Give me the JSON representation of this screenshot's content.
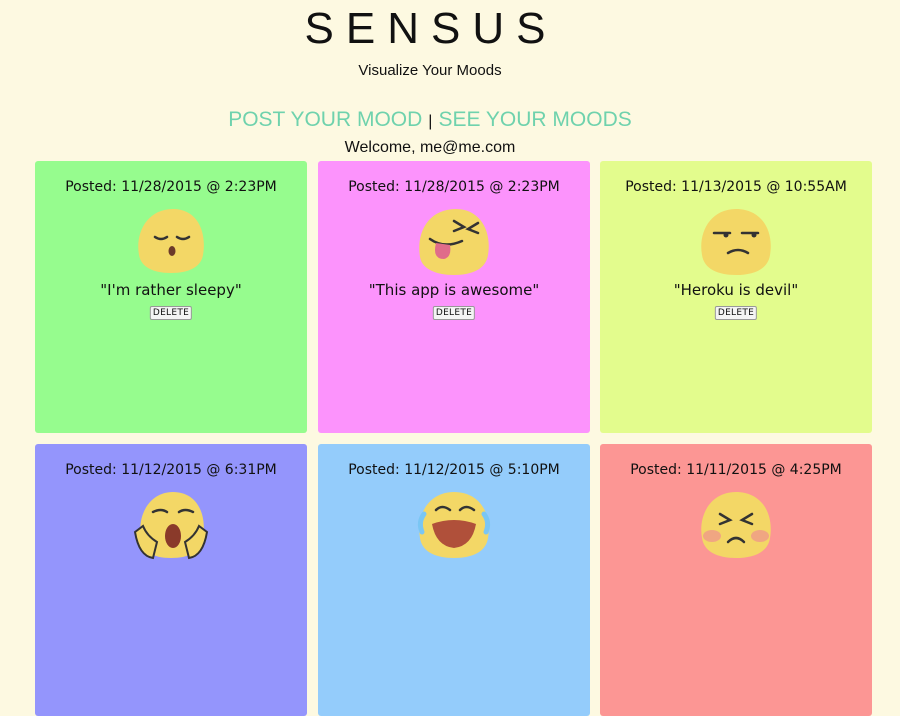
{
  "header": {
    "logo": "SENSUS",
    "tagline": "Visualize Your Moods",
    "nav_post": "POST YOUR MOOD",
    "nav_sep": "|",
    "nav_see": "SEE YOUR MOODS",
    "welcome": "Welcome, me@me.com"
  },
  "colors": {
    "background": "#fdf9e1",
    "accent": "#6fd2ad"
  },
  "moods": [
    {
      "posted": "Posted: 11/28/2015 @ 2:23PM",
      "quote": "\"I'm rather sleepy\"",
      "delete": "DELETE",
      "emoji": "sleepy-face-icon",
      "color": "#96fc8e"
    },
    {
      "posted": "Posted: 11/28/2015 @ 2:23PM",
      "quote": "\"This app is awesome\"",
      "delete": "DELETE",
      "emoji": "tongue-out-face-icon",
      "color": "#fc93fc"
    },
    {
      "posted": "Posted: 11/13/2015 @ 10:55AM",
      "quote": "\"Heroku is devil\"",
      "delete": "DELETE",
      "emoji": "unamused-face-icon",
      "color": "#e3fc8d"
    },
    {
      "posted": "Posted: 11/12/2015 @ 6:31PM",
      "emoji": "screaming-face-icon",
      "color": "#9495fc"
    },
    {
      "posted": "Posted: 11/12/2015 @ 5:10PM",
      "emoji": "loudly-crying-face-icon",
      "color": "#94ccfb"
    },
    {
      "posted": "Posted: 11/11/2015 @ 4:25PM",
      "emoji": "angry-face-icon",
      "color": "#fc9694"
    }
  ]
}
